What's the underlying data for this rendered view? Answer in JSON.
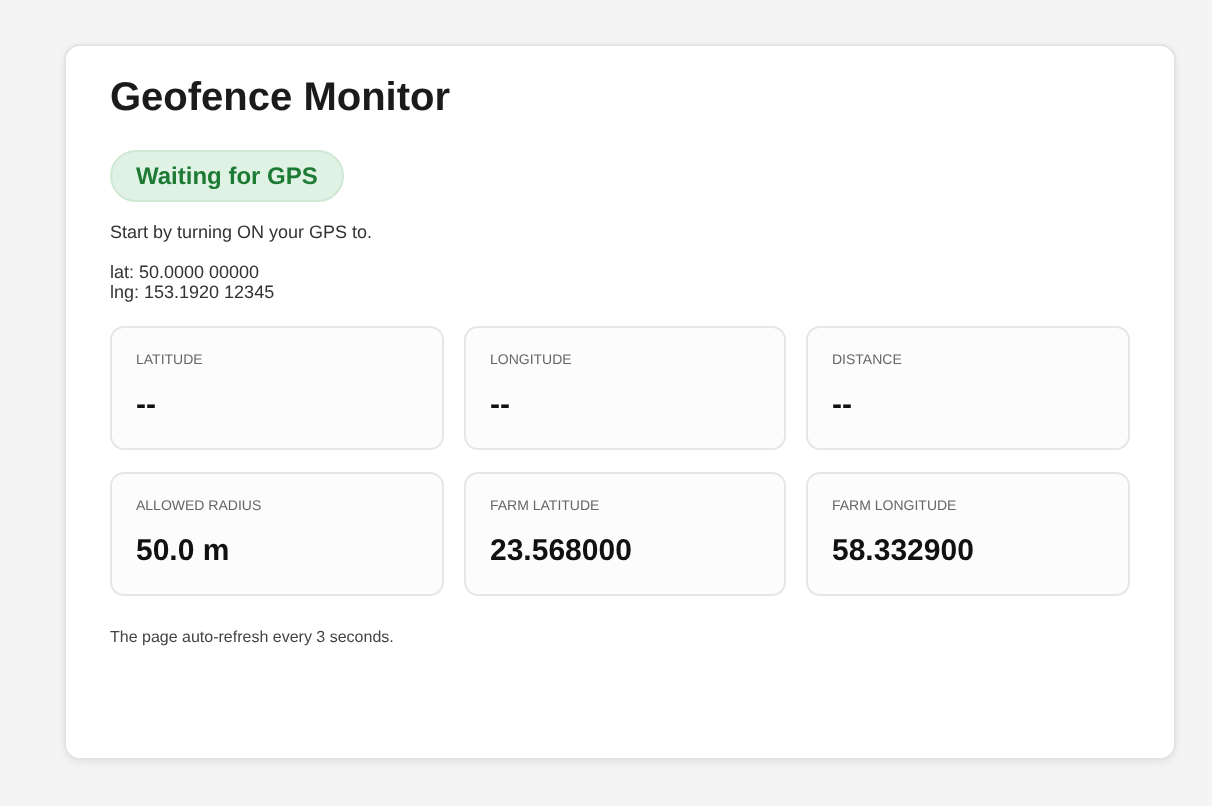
{
  "title": "Geofence Monitor",
  "status": {
    "label": "Waiting for GPS",
    "kind": "waiting"
  },
  "message": "Start by turning ON your GPS to.",
  "coords": [
    "lat: 50.0000 00000",
    "lng: 153.1920 12345"
  ],
  "stats": [
    {
      "label": "LATITUDE",
      "value": "--"
    },
    {
      "label": "LONGITUDE",
      "value": "--"
    },
    {
      "label": "DISTANCE",
      "value": "--"
    },
    {
      "label": "ALLOWED RADIUS",
      "value": "50.0 m"
    },
    {
      "label": "FARM LATITUDE",
      "value": "23.568000"
    },
    {
      "label": "FARM LONGITUDE",
      "value": "58.332900"
    }
  ],
  "footer": "The page auto-refresh every 3 seconds."
}
